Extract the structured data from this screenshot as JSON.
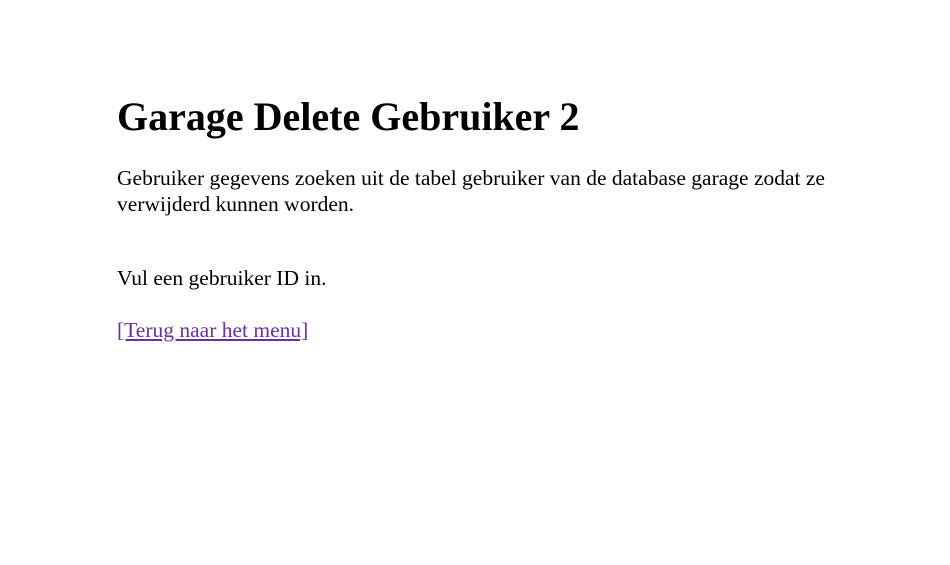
{
  "page": {
    "title": "Garage Delete Gebruiker 2",
    "description": "Gebruiker gegevens zoeken uit de tabel gebruiker van de database garage zodat ze verwijderd kunnen worden.",
    "prompt": "Vul een gebruiker ID in.",
    "back_link": "[Terug naar het menu]"
  },
  "colors": {
    "link_visited": "#6b2fa0",
    "text": "#000000",
    "background": "#ffffff"
  }
}
